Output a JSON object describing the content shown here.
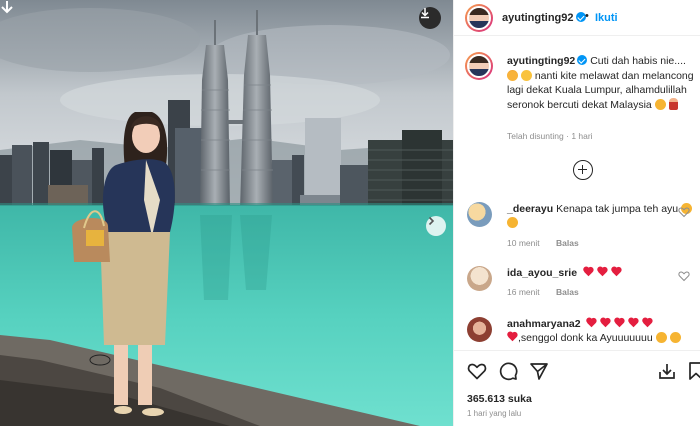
{
  "post": {
    "username": "ayutingting92",
    "follow_label": "Ikuti",
    "dot_separator": "•",
    "caption_text_1": "Cuti dah habis nie....",
    "caption_text_2": "nanti kite melawat dan melancong lagi dekat Kuala Lumpur, alhamdulillah seronok bercuti dekat Malaysia",
    "caption_meta_label": "Telah disunting",
    "caption_meta_sep": "·",
    "caption_meta_time": "1 hari"
  },
  "comments": [
    {
      "username": "_deerayu",
      "text": "Kenapa tak jumpa teh ayu",
      "time": "10 menit",
      "reply_label": "Balas",
      "avatar_color": "#b9a27c"
    },
    {
      "username": "ida_ayou_srie",
      "text": "",
      "time": "16 menit",
      "reply_label": "Balas",
      "avatar_color": "#d8c7b4"
    },
    {
      "username": "anahmaryana2",
      "text": ",senggol donk ka Ayuuuuuuu",
      "time": "",
      "reply_label": "",
      "avatar_color": "#8d3f32"
    }
  ],
  "actions": {
    "likes_count": "365.613 suka",
    "time_ago": "1 hari yang lalu",
    "icons": [
      "heart-icon",
      "comment-icon",
      "share-icon",
      "bookmark-icon",
      "save-icon"
    ]
  },
  "colors": {
    "accent_blue": "#0095f6",
    "text_dark": "#262626",
    "meta_grey": "#8e8e8e",
    "pool_water": "#47c5b6",
    "heart_red": "#e41e3f"
  }
}
